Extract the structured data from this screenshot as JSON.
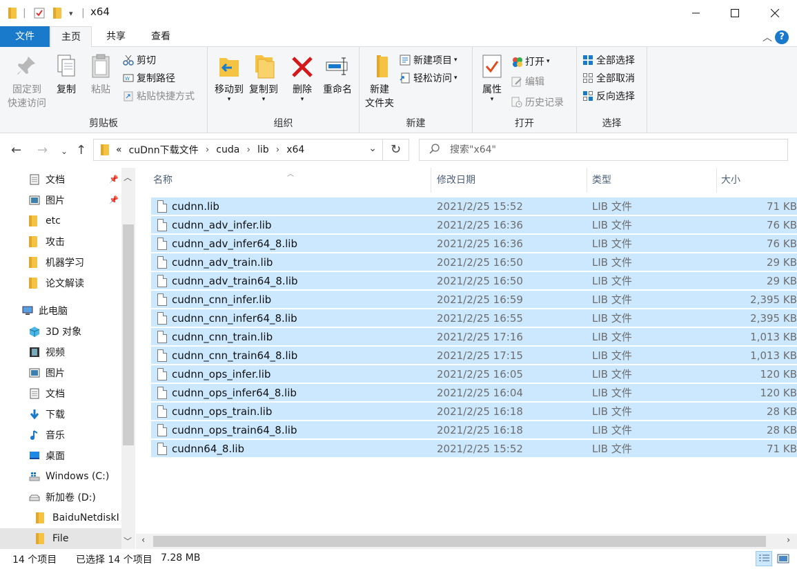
{
  "window": {
    "title": "x64"
  },
  "ribbon_tabs": [
    "文件",
    "主页",
    "共享",
    "查看"
  ],
  "help_label": "?",
  "ribbon": {
    "clipboard": {
      "pin_line1": "固定到",
      "pin_line2": "快速访问",
      "copy": "复制",
      "paste": "粘贴",
      "cut": "剪切",
      "copy_path": "复制路径",
      "paste_shortcut": "粘贴快捷方式",
      "group_label": "剪贴板"
    },
    "organize": {
      "move_to": "移动到",
      "copy_to": "复制到",
      "delete": "删除",
      "rename": "重命名",
      "group_label": "组织"
    },
    "new": {
      "new_folder_line1": "新建",
      "new_folder_line2": "文件夹",
      "new_item": "新建项目",
      "easy_access": "轻松访问",
      "group_label": "新建"
    },
    "open": {
      "properties": "属性",
      "open": "打开",
      "edit": "编辑",
      "history": "历史记录",
      "group_label": "打开"
    },
    "select": {
      "select_all": "全部选择",
      "select_none": "全部取消",
      "invert": "反向选择",
      "group_label": "选择"
    }
  },
  "address": {
    "overflow": "«",
    "crumbs": [
      "cuDnn下载文件",
      "cuda",
      "lib",
      "x64"
    ],
    "sep": "›"
  },
  "search": {
    "placeholder": "搜索\"x64\""
  },
  "sidebar": {
    "quick": [
      {
        "label": "文档",
        "pinned": true
      },
      {
        "label": "图片",
        "pinned": true
      },
      {
        "label": "etc"
      },
      {
        "label": "攻击"
      },
      {
        "label": "机器学习"
      },
      {
        "label": "论文解读"
      }
    ],
    "this_pc": "此电脑",
    "pc_items": [
      "3D 对象",
      "视频",
      "图片",
      "文档",
      "下载",
      "音乐",
      "桌面",
      "Windows (C:)",
      "新加卷 (D:)"
    ],
    "d_items": [
      "BaiduNetdiskI",
      "File"
    ]
  },
  "columns": {
    "name": "名称",
    "date": "修改日期",
    "type": "类型",
    "size": "大小"
  },
  "files": [
    {
      "name": "cudnn.lib",
      "date": "2021/2/25 15:52",
      "type": "LIB 文件",
      "size": "71 KB"
    },
    {
      "name": "cudnn_adv_infer.lib",
      "date": "2021/2/25 16:36",
      "type": "LIB 文件",
      "size": "76 KB"
    },
    {
      "name": "cudnn_adv_infer64_8.lib",
      "date": "2021/2/25 16:36",
      "type": "LIB 文件",
      "size": "76 KB"
    },
    {
      "name": "cudnn_adv_train.lib",
      "date": "2021/2/25 16:50",
      "type": "LIB 文件",
      "size": "29 KB"
    },
    {
      "name": "cudnn_adv_train64_8.lib",
      "date": "2021/2/25 16:50",
      "type": "LIB 文件",
      "size": "29 KB"
    },
    {
      "name": "cudnn_cnn_infer.lib",
      "date": "2021/2/25 16:59",
      "type": "LIB 文件",
      "size": "2,395 KB"
    },
    {
      "name": "cudnn_cnn_infer64_8.lib",
      "date": "2021/2/25 16:55",
      "type": "LIB 文件",
      "size": "2,395 KB"
    },
    {
      "name": "cudnn_cnn_train.lib",
      "date": "2021/2/25 17:16",
      "type": "LIB 文件",
      "size": "1,013 KB"
    },
    {
      "name": "cudnn_cnn_train64_8.lib",
      "date": "2021/2/25 17:15",
      "type": "LIB 文件",
      "size": "1,013 KB"
    },
    {
      "name": "cudnn_ops_infer.lib",
      "date": "2021/2/25 16:05",
      "type": "LIB 文件",
      "size": "120 KB"
    },
    {
      "name": "cudnn_ops_infer64_8.lib",
      "date": "2021/2/25 16:04",
      "type": "LIB 文件",
      "size": "120 KB"
    },
    {
      "name": "cudnn_ops_train.lib",
      "date": "2021/2/25 16:18",
      "type": "LIB 文件",
      "size": "28 KB"
    },
    {
      "name": "cudnn_ops_train64_8.lib",
      "date": "2021/2/25 16:18",
      "type": "LIB 文件",
      "size": "28 KB"
    },
    {
      "name": "cudnn64_8.lib",
      "date": "2021/2/25 15:52",
      "type": "LIB 文件",
      "size": "71 KB"
    }
  ],
  "status": {
    "count": "14 个项目",
    "selected": "已选择 14 个项目",
    "size": "7.28 MB"
  },
  "colors": {
    "accent": "#1979ca",
    "selection": "#cce8ff",
    "folder": "#f5c343"
  }
}
